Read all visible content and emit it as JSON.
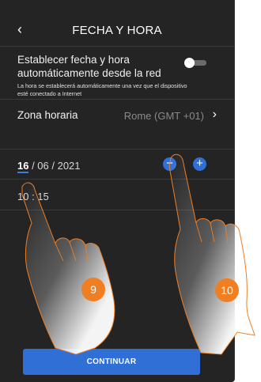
{
  "header": {
    "title": "FECHA Y HORA",
    "back_icon": "‹"
  },
  "auto": {
    "label": "Establecer fecha y hora automáticamente desde la red",
    "description": "La hora se establecerá automáticamente una vez que el dispositivo esté conectado a Internet",
    "enabled": false
  },
  "timezone": {
    "label": "Zona horaria",
    "value": "Rome (GMT +01)",
    "chevron": "›"
  },
  "date": {
    "day": "16",
    "rest": " / 06 / 2021",
    "minus": "−",
    "plus": "+"
  },
  "time": {
    "value": "10 : 15"
  },
  "steps": {
    "first": "9",
    "second": "10"
  },
  "footer": {
    "continue_label": "CONTINUAR"
  },
  "colors": {
    "accent": "#2f6fd6",
    "badge": "#f07e22",
    "background": "#242424"
  }
}
